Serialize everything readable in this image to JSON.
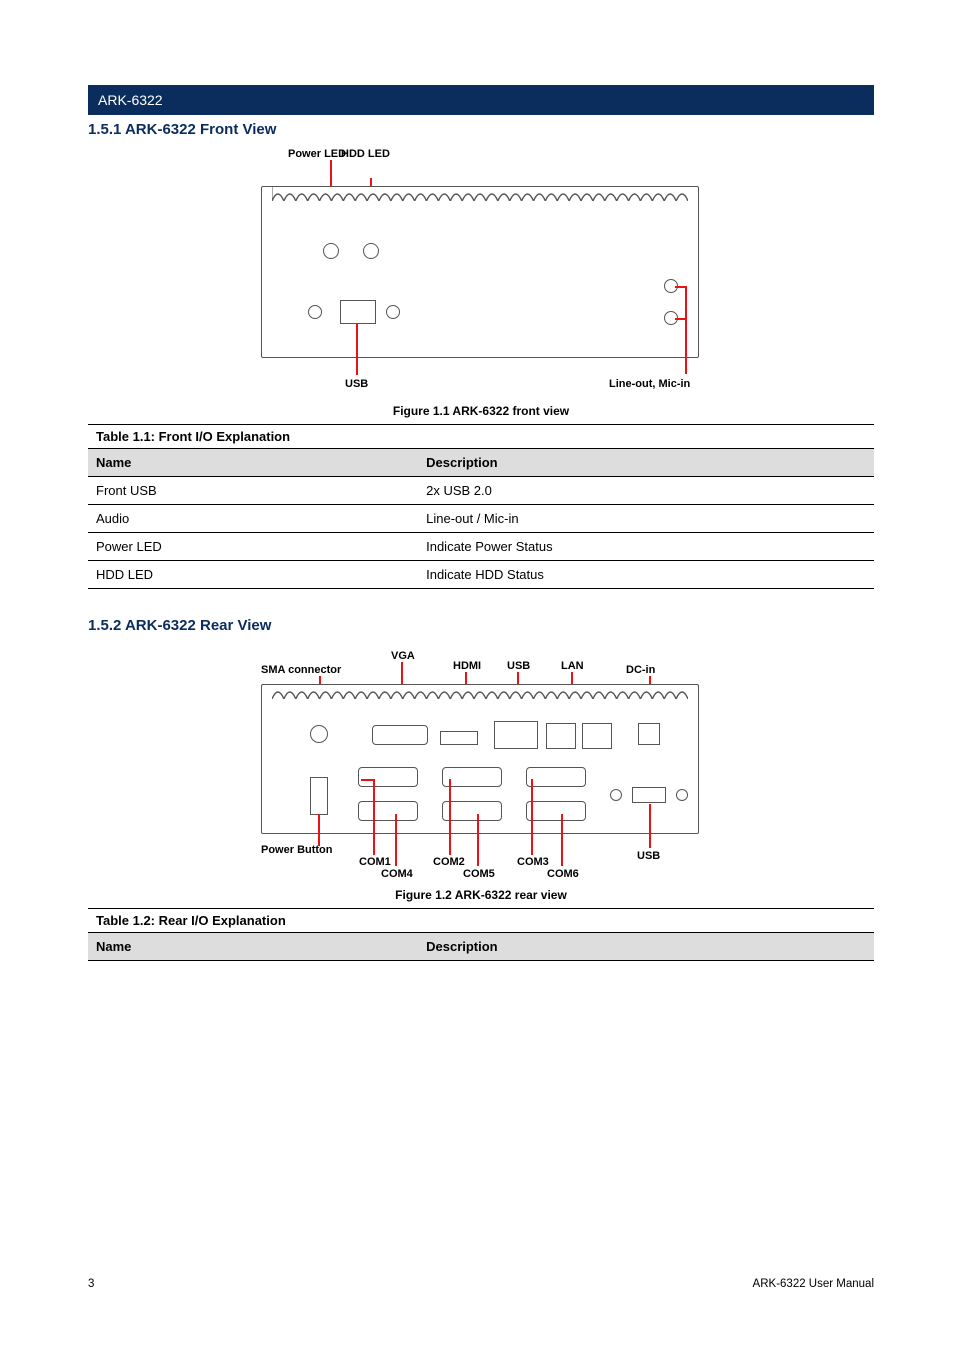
{
  "banner": "ARK-6322",
  "section1": {
    "title": "1.5.1 ARK-6322 Front View",
    "labels": {
      "power_led": "Power LED",
      "hdd_led": "HDD LED",
      "usb": "USB",
      "lineout_micin": "Line-out, Mic-in"
    },
    "figure_caption": "Figure 1.1 ARK-6322 front view",
    "table_caption": "Table 1.1: Front I/O Explanation",
    "columns": [
      "Name",
      "Description"
    ],
    "rows": [
      [
        "Front USB",
        "2x USB 2.0"
      ],
      [
        "Audio",
        "Line-out / Mic-in"
      ],
      [
        "Power LED",
        "Indicate Power Status"
      ],
      [
        "HDD LED",
        "Indicate HDD Status"
      ]
    ]
  },
  "section2": {
    "title": "1.5.2 ARK-6322 Rear View",
    "labels": {
      "sma": "SMA connector",
      "vga": "VGA",
      "hdmi": "HDMI",
      "usb_top": "USB",
      "lan": "LAN",
      "dcin": "DC-in",
      "power_button": "Power Button",
      "com1": "COM1",
      "com4": "COM4",
      "com2": "COM2",
      "com5": "COM5",
      "com3": "COM3",
      "com6": "COM6",
      "usb_bottom": "USB"
    },
    "figure_caption": "Figure 1.2 ARK-6322 rear view",
    "table_caption": "Table 1.2: Rear I/O Explanation",
    "columns": [
      "Name",
      "Description"
    ],
    "rows": []
  },
  "footer": {
    "left": "3",
    "right": "ARK-6322 User Manual"
  }
}
